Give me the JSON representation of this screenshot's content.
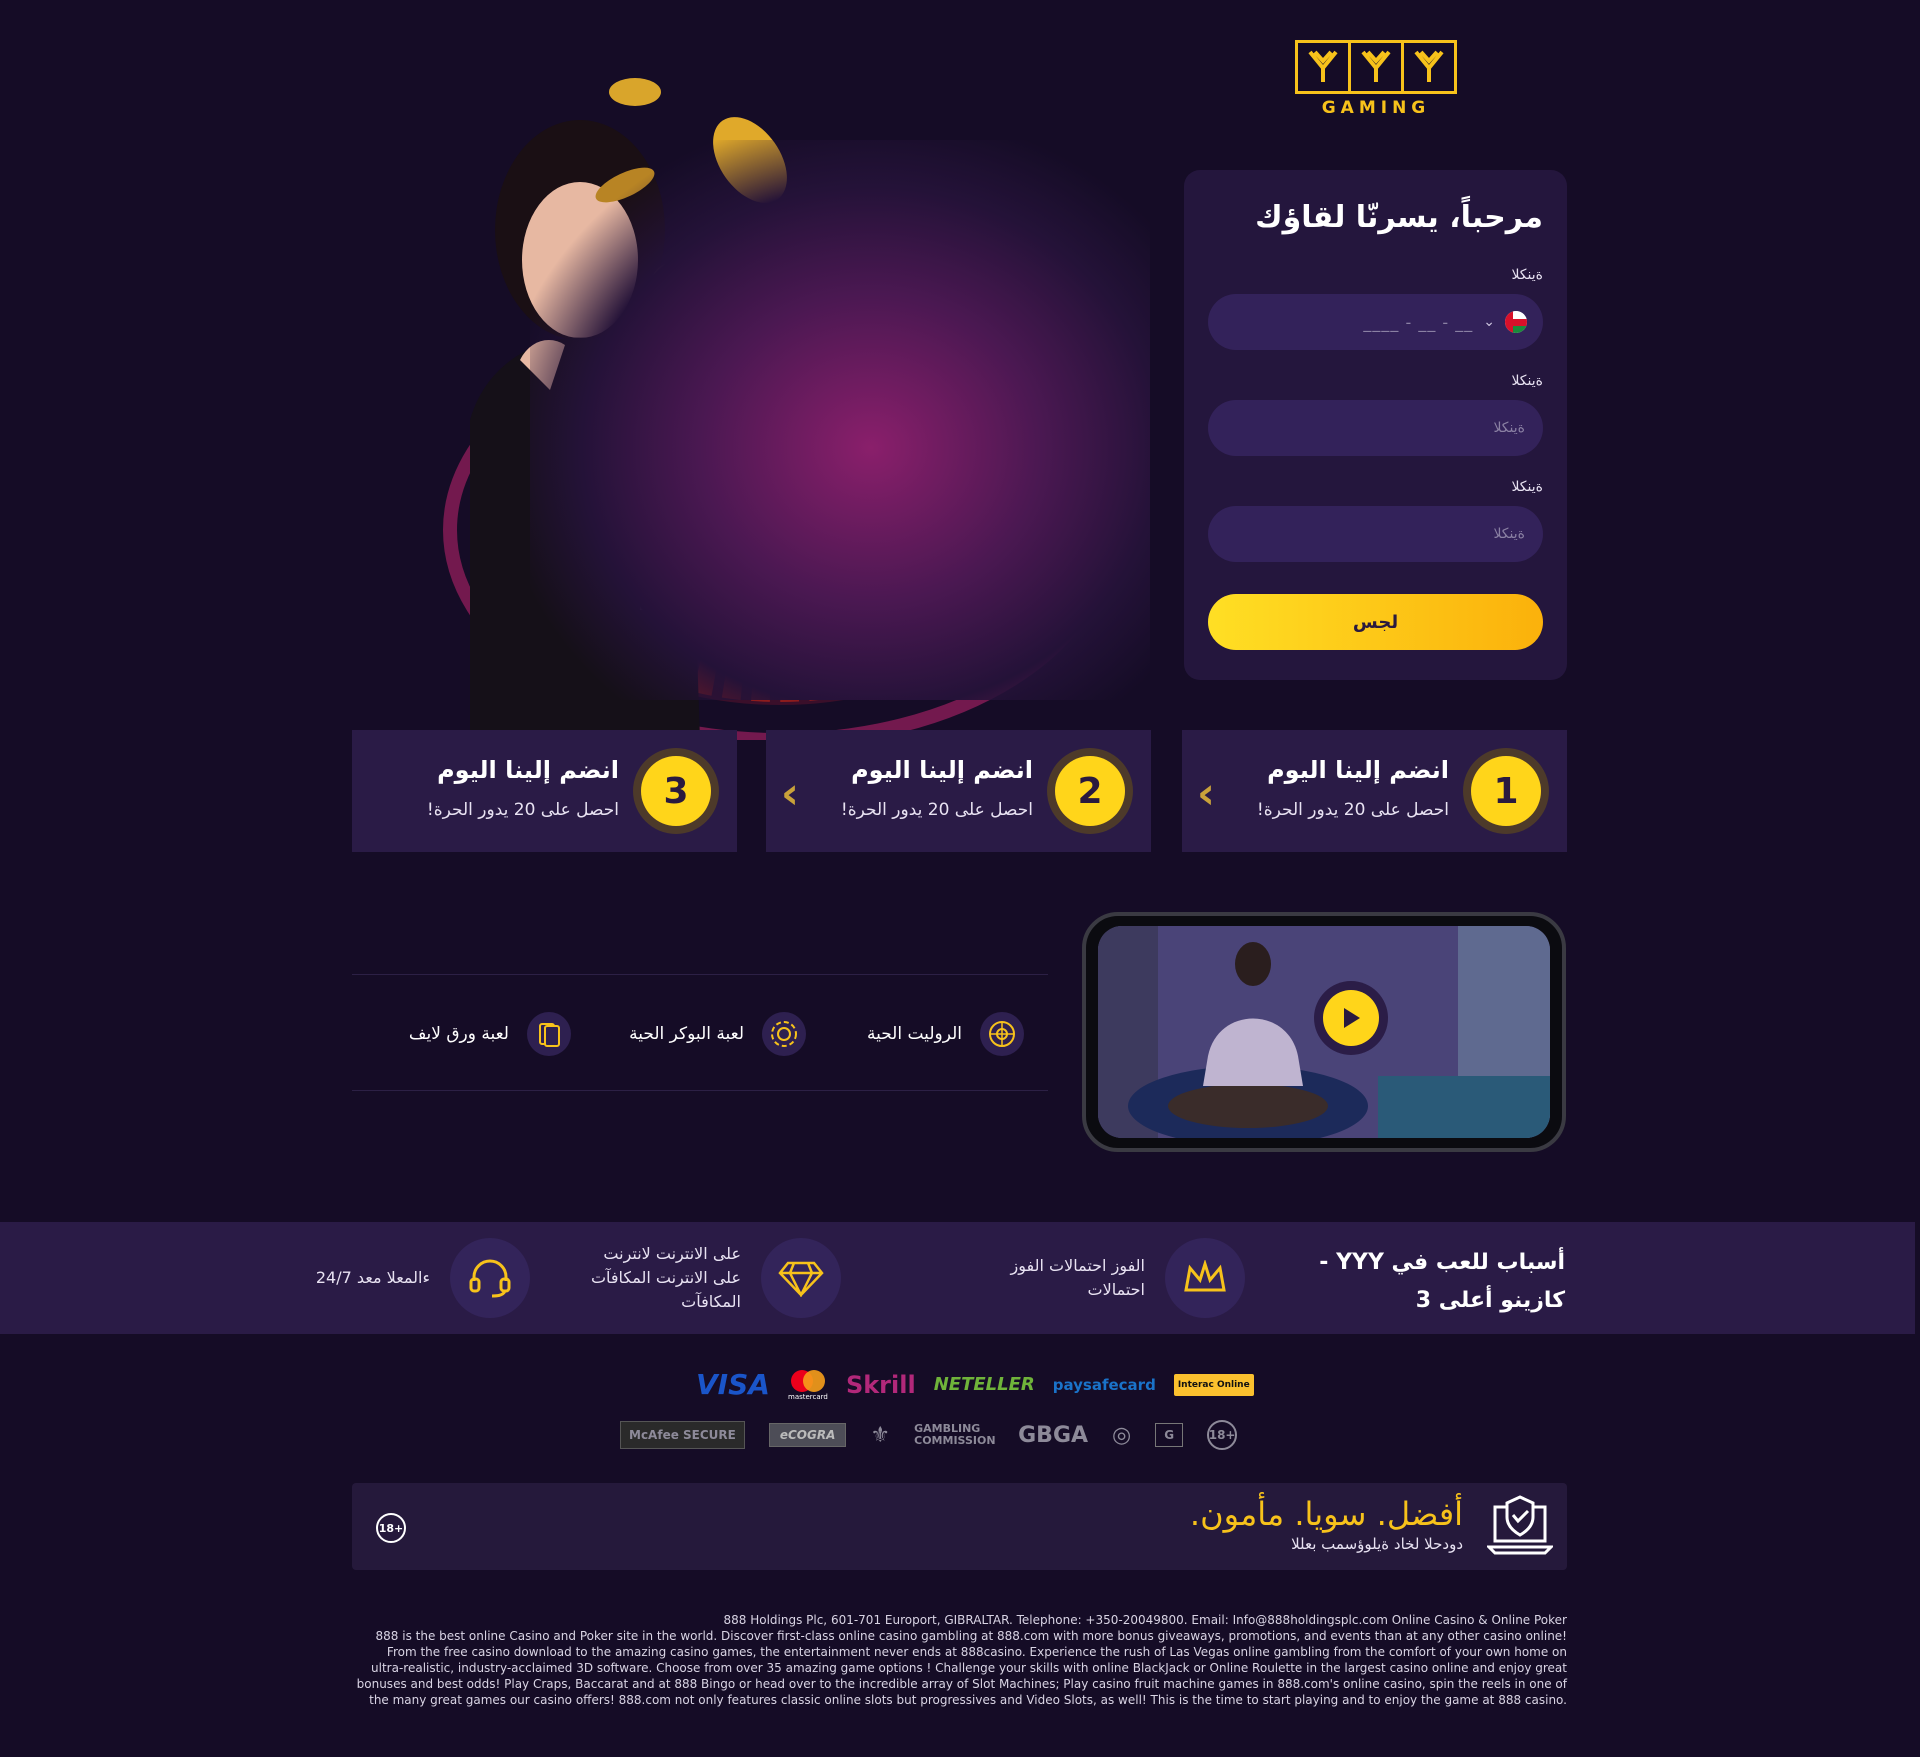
{
  "logo": {
    "letters": [
      "Y",
      "Y",
      "Y"
    ],
    "text": "GAMING"
  },
  "form": {
    "title": "مرحباً، يسرنّا لقاؤك",
    "phone": {
      "label": "ةينكلا",
      "mask": "____ - __ - __",
      "country_flag": "oman-flag",
      "chevron": "chevron-down-icon"
    },
    "field2": {
      "label": "ةينكلا",
      "placeholder": "ةينكلا"
    },
    "field3": {
      "label": "ةينكلا",
      "placeholder": "ةينكلا"
    },
    "submit_label": "لجس"
  },
  "steps": [
    {
      "number": "1",
      "title": "انضم إلينا اليوم",
      "subtitle": "احصل على 20 يدور الحرة!"
    },
    {
      "number": "2",
      "title": "انضم إلينا اليوم",
      "subtitle": "احصل على 20 يدور الحرة!"
    },
    {
      "number": "3",
      "title": "انضم إلينا اليوم",
      "subtitle": "احصل على 20 يدور الحرة!"
    }
  ],
  "games": [
    {
      "label": "الروليت الحية",
      "icon": "roulette-icon"
    },
    {
      "label": "لعبة البوكر الحية",
      "icon": "poker-chip-icon"
    },
    {
      "label": "لعبة ورق لايف",
      "icon": "cards-icon"
    }
  ],
  "reasons": {
    "title": "أسباب للعب في YYY - كازينو أعلى 3",
    "items": [
      {
        "text_lines": [
          "الفوز احتمالات الفوز",
          "احتمالات"
        ],
        "icon": "crown-icon"
      },
      {
        "text_lines": [
          "على الانترنت لانترنت",
          "على الانترنت المكافآت",
          "المكافآت"
        ],
        "icon": "diamond-icon"
      },
      {
        "text_lines": [
          "ءالمعلا معد 24/7"
        ],
        "icon": "headset-icon"
      }
    ]
  },
  "payments": [
    "VISA",
    "mastercard",
    "Skrill",
    "NETELLER",
    "paysafecard",
    "Interac Online"
  ],
  "certifications": [
    "McAfee SECURE",
    "eCOGRA",
    "GAMBLING COMMISSION",
    "GBGA",
    "18+"
  ],
  "safe_banner": {
    "main": "أفضل. سويا. مأمون.",
    "sub": "دودحلا لخاد ةيلوؤسمب بعللا",
    "age_badge": "18+"
  },
  "footer": {
    "line1": "888 Holdings Plc, 601-701 Europort, GIBRALTAR. Telephone: +350-20049800. Email: Info@888holdingsplc.com Online Casino & Online Poker",
    "paragraph": "888 is the best online Casino and Poker site in the world. Discover first-class online casino gambling at 888.com with more bonus giveaways, promotions, and events than at any other casino online! From the free casino download to the amazing casino games, the entertainment never ends at 888casino. Experience the rush of Las Vegas online gambling from the comfort of your own home on ultra-realistic, industry-acclaimed 3D software. Choose from over 35 amazing game options ! Challenge your skills with online BlackJack or Online Roulette in the largest casino online and enjoy great bonuses and best odds! Play Craps, Baccarat and at 888 Bingo or head over to the incredible array of Slot Machines; Play casino fruit machine games in 888.com's online casino, spin the reels in one of the many great games our casino offers! 888.com not only features classic online slots but progressives and Video Slots, as well! This is the time to start playing and to enjoy the game at 888 casino."
  },
  "colors": {
    "background": "#150c26",
    "panel": "#2a1b46",
    "accent": "#f7c21b"
  }
}
